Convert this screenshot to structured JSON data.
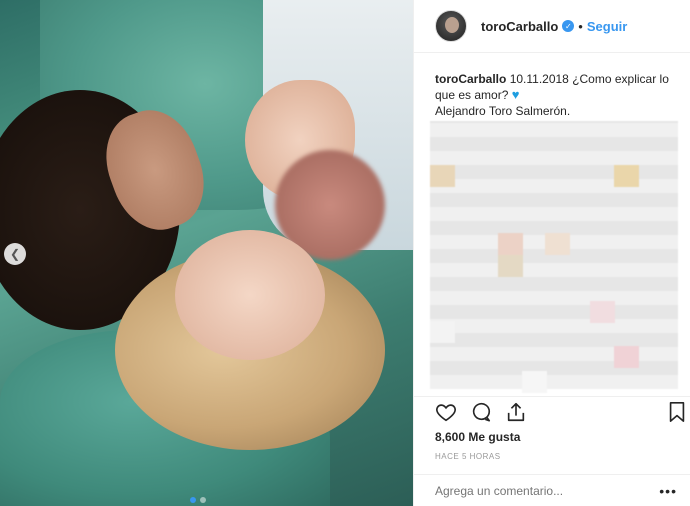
{
  "post": {
    "username": "toroCarballo",
    "follow_label": "Seguir",
    "separator": "•",
    "caption_user": "toroCarballo",
    "caption_text": "10.11.2018 ¿Como explicar lo que es amor?",
    "caption_line2": "Alejandro Toro Salmerón.",
    "likes": "8,600 Me gusta",
    "time_ago": "HACE 5 HORAS",
    "comment_placeholder": "Agrega un comentario...",
    "more_label": "•••"
  },
  "icons": {
    "heart_emoji": "heart-icon",
    "nav": "chevron-left-icon",
    "like": "heart-outline-icon",
    "comment": "comment-icon",
    "share": "share-icon",
    "save": "bookmark-icon"
  },
  "colors": {
    "accent": "#3897f0",
    "heart_emoji": "#1e9ee0"
  }
}
